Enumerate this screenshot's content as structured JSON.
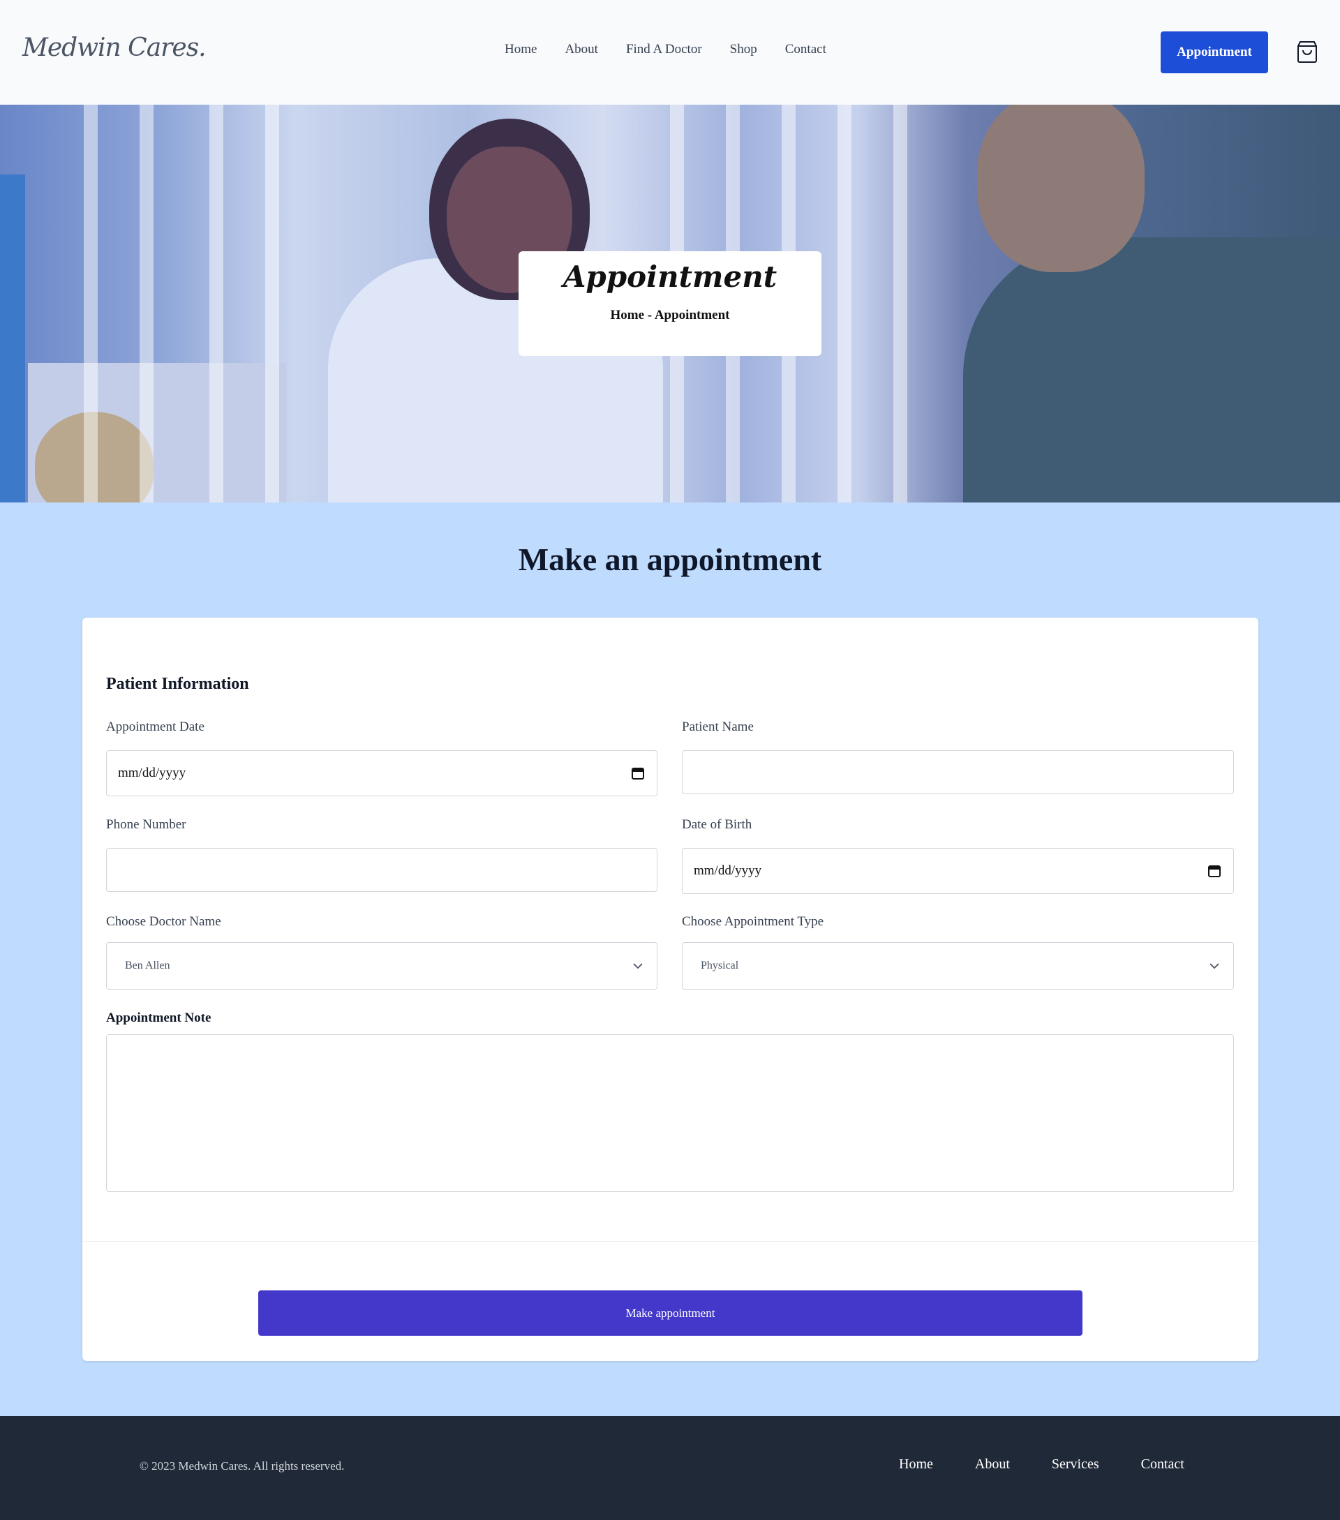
{
  "brand": {
    "logo_text": "Medwin Cares."
  },
  "nav": {
    "items": [
      "Home",
      "About",
      "Find A Doctor",
      "Shop",
      "Contact"
    ]
  },
  "header": {
    "appointment_label": "Appointment"
  },
  "icons": {
    "cart": "shopping-bag-icon",
    "calendar": "calendar-icon",
    "chevron": "chevron-down-icon"
  },
  "hero": {
    "title": "Appointment",
    "breadcrumb": "Home - Appointment"
  },
  "main": {
    "title": "Make an appointment"
  },
  "form": {
    "section_title": "Patient Information",
    "appointment_date": {
      "label": "Appointment Date",
      "placeholder": "mm/dd/yyyy"
    },
    "patient_name": {
      "label": "Patient Name",
      "value": ""
    },
    "phone_number": {
      "label": "Phone Number",
      "value": ""
    },
    "date_of_birth": {
      "label": "Date of Birth",
      "placeholder": "mm/dd/yyyy"
    },
    "doctor": {
      "label": "Choose Doctor Name",
      "selected": "Ben Allen"
    },
    "appointment_type": {
      "label": "Choose Appointment Type",
      "selected": "Physical"
    },
    "note": {
      "label": "Appointment Note",
      "value": ""
    },
    "submit_label": "Make appointment"
  },
  "footer": {
    "copyright": "© 2023 Medwin Cares. All rights reserved.",
    "links": [
      "Home",
      "About",
      "Services",
      "Contact"
    ]
  },
  "colors": {
    "primary": "#1d4ed8",
    "submit": "#4338ca",
    "page_bg": "#bfdbfe",
    "footer_bg": "#1f2937"
  }
}
